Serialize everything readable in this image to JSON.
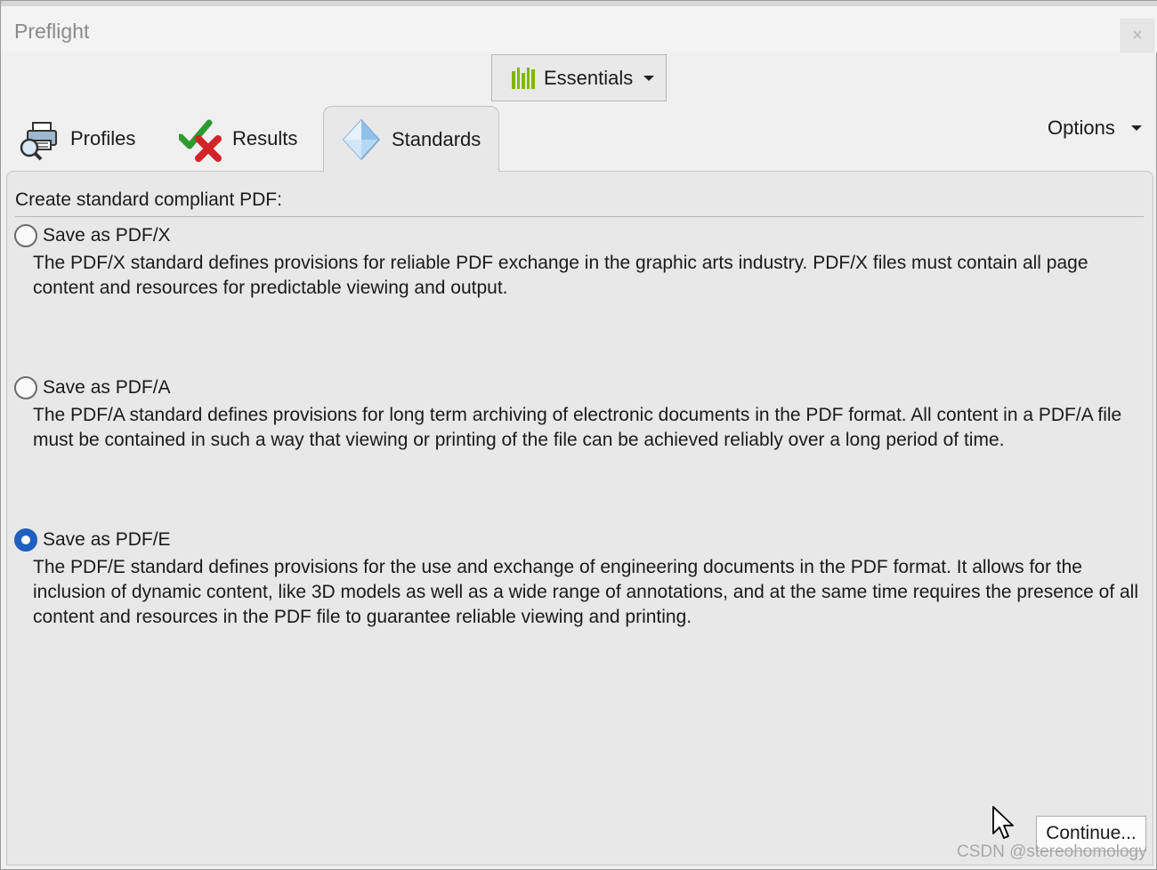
{
  "window": {
    "title": "Preflight",
    "close_label": "×"
  },
  "workspace": {
    "label": "Essentials",
    "icon": "bar-chart-icon",
    "accent": "#7fb800"
  },
  "tabs": [
    {
      "label": "Profiles",
      "icon": "printer-magnifier-icon",
      "active": false
    },
    {
      "label": "Results",
      "icon": "check-cross-icon",
      "active": false
    },
    {
      "label": "Standards",
      "icon": "diamond-icon",
      "active": true
    }
  ],
  "options": {
    "label": "Options"
  },
  "panel": {
    "heading": "Create standard compliant PDF:",
    "options": [
      {
        "label": "Save as PDF/X",
        "checked": false,
        "description": "The PDF/X standard defines provisions for reliable PDF exchange in the graphic arts industry. PDF/X files must contain all page content and resources for predictable viewing and output."
      },
      {
        "label": "Save as PDF/A",
        "checked": false,
        "description": "The PDF/A standard defines provisions for long term archiving of electronic documents in the PDF format. All content in a PDF/A file must be contained in such a way that viewing or printing of the file can be achieved reliably over a long period of time."
      },
      {
        "label": "Save as PDF/E",
        "checked": true,
        "description": "The PDF/E standard defines provisions for the use and exchange of engineering documents in the PDF format. It allows for the inclusion of dynamic content, like 3D models as well as a wide range of annotations, and at the same time requires the presence of all content and resources in the PDF file to guarantee reliable viewing and printing."
      }
    ]
  },
  "footer": {
    "continue_label": "Continue..."
  },
  "watermark": "CSDN @stereohomology",
  "colors": {
    "radio_selected": "#1f5fbf",
    "check_green": "#2e9b2e",
    "cross_red": "#d3222a"
  }
}
